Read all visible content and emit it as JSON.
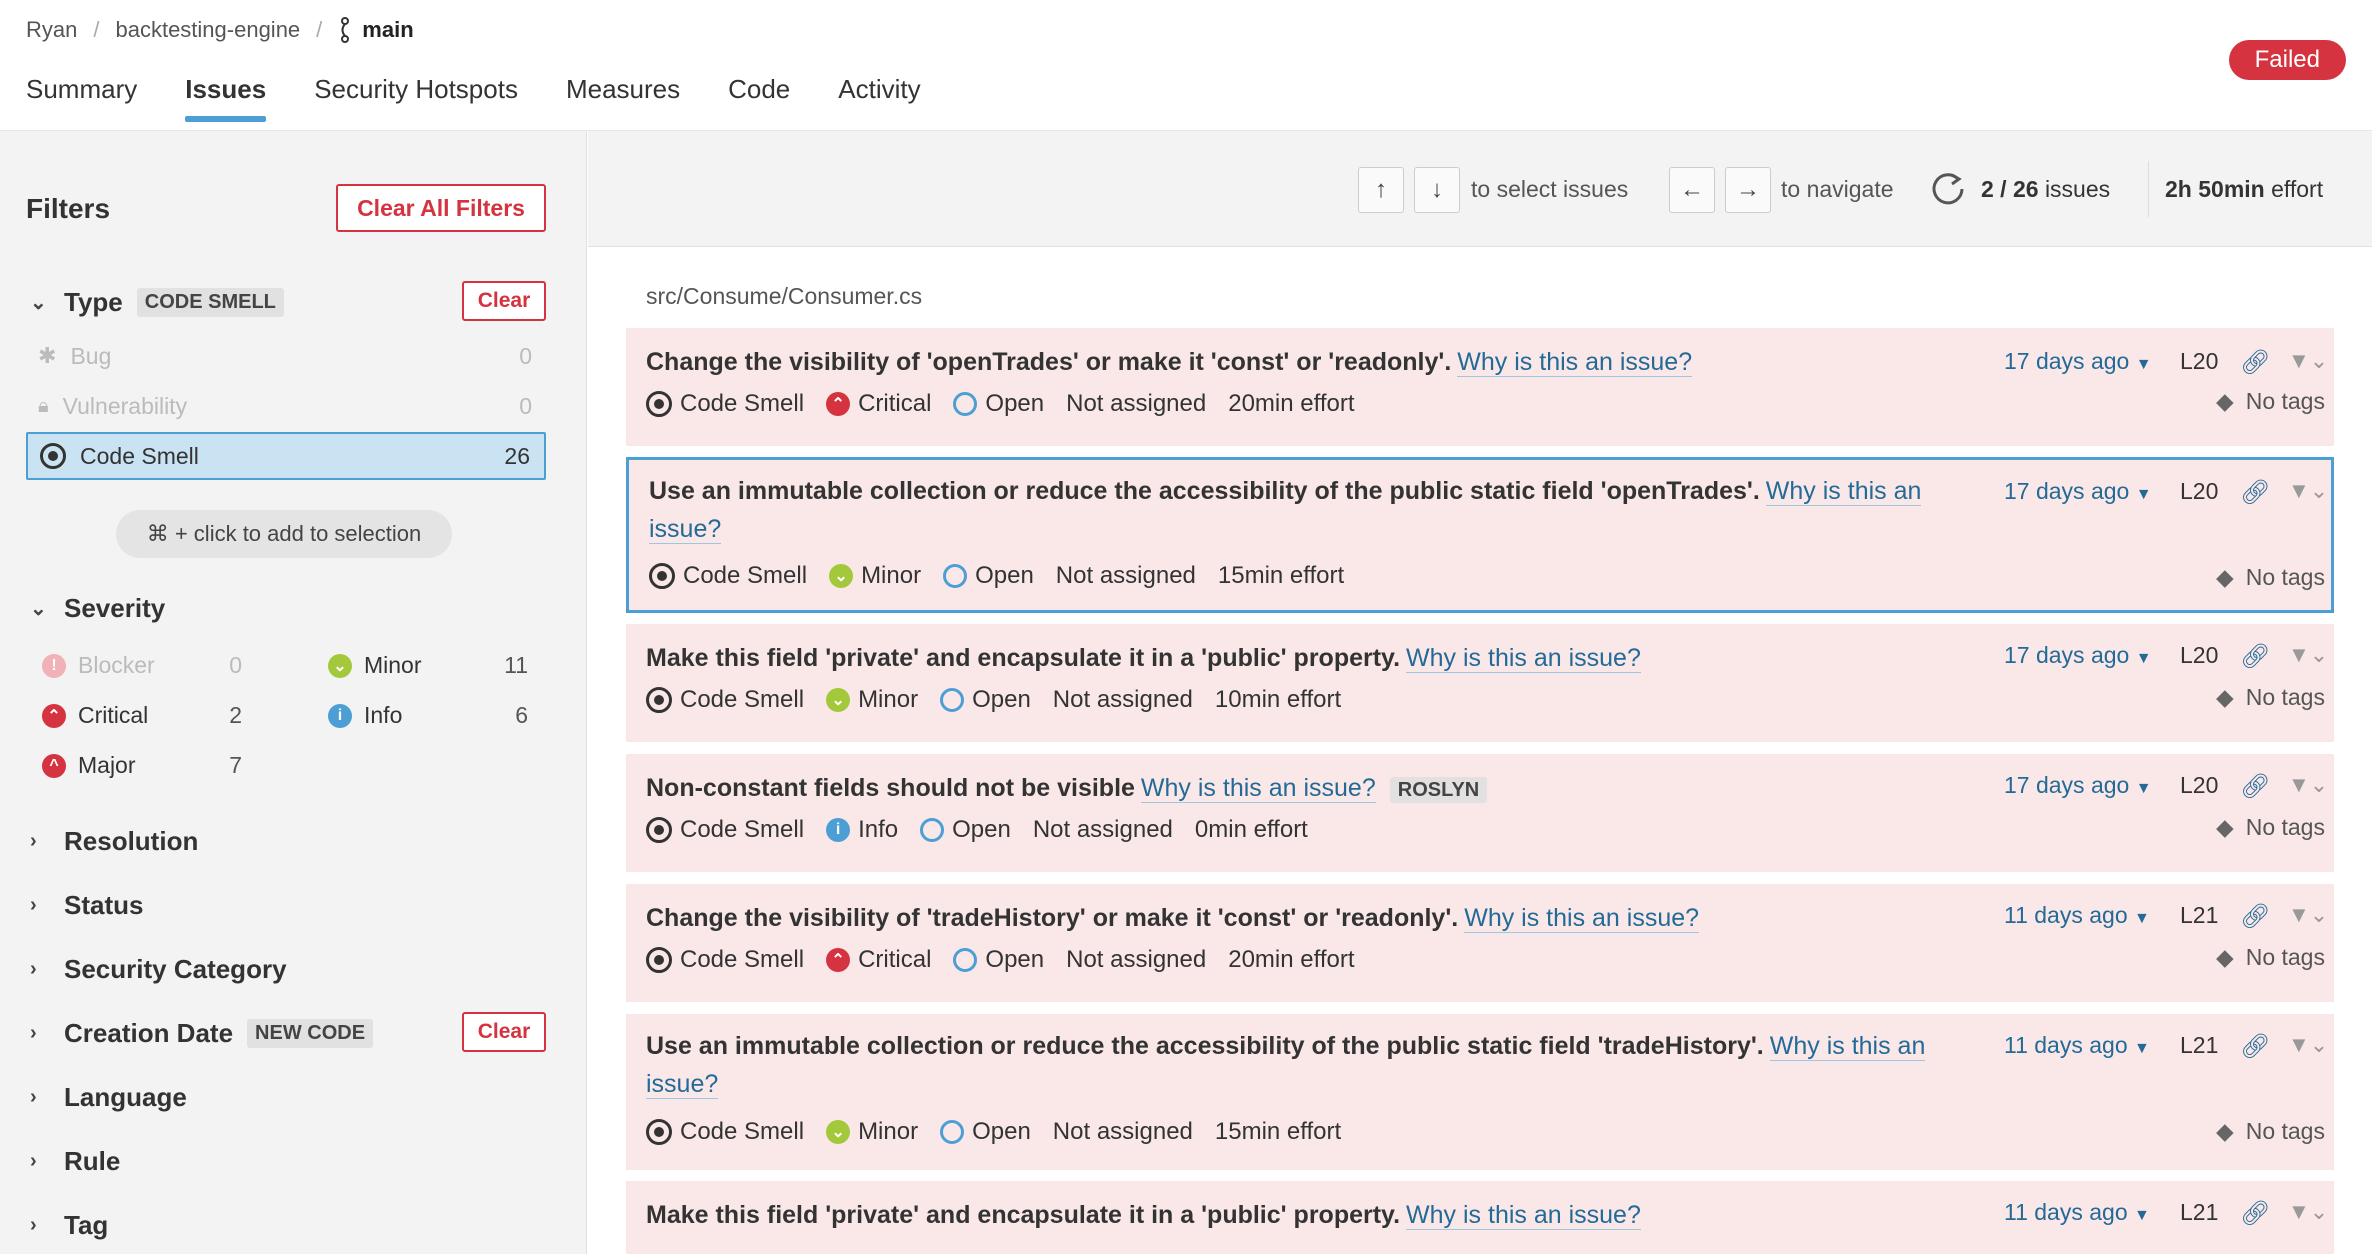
{
  "breadcrumb": {
    "user": "Ryan",
    "project": "backtesting-engine",
    "branch": "main",
    "sep": "/"
  },
  "tabs": [
    "Summary",
    "Issues",
    "Security Hotspots",
    "Measures",
    "Code",
    "Activity"
  ],
  "quality_gate": "Failed",
  "sidebar": {
    "title": "Filters",
    "clear_all": "Clear All Filters",
    "type": {
      "label": "Type",
      "chip": "CODE SMELL",
      "clear": "Clear",
      "items": [
        {
          "label": "Bug",
          "count": "0"
        },
        {
          "label": "Vulnerability",
          "count": "0"
        },
        {
          "label": "Code Smell",
          "count": "26"
        }
      ]
    },
    "hint": "⌘ + click to add to selection",
    "severity": {
      "label": "Severity",
      "items": [
        {
          "label": "Blocker",
          "count": "0"
        },
        {
          "label": "Critical",
          "count": "2"
        },
        {
          "label": "Major",
          "count": "7"
        },
        {
          "label": "Minor",
          "count": "11"
        },
        {
          "label": "Info",
          "count": "6"
        }
      ]
    },
    "resolution": "Resolution",
    "status": "Status",
    "security_category": "Security Category",
    "creation_date": {
      "label": "Creation Date",
      "chip": "NEW CODE",
      "clear": "Clear"
    },
    "language": "Language",
    "rule": "Rule",
    "tag": "Tag"
  },
  "toolbar": {
    "up": "↑",
    "down": "↓",
    "select_text": "to select issues",
    "left": "←",
    "right": "→",
    "nav_text": "to navigate",
    "current": "2 / 26",
    "issues_word": "issues",
    "effort_value": "2h 50min",
    "effort_word": "effort"
  },
  "file_path": "src/Consume/Consumer.cs",
  "why_label": "Why is this an issue?",
  "issues": [
    {
      "title": "Change the visibility of 'openTrades' or make it 'const' or 'readonly'.",
      "type": "Code Smell",
      "severity": "Critical",
      "status": "Open",
      "assignee": "Not assigned",
      "effort": "20min effort",
      "age": "17 days ago",
      "line": "L20",
      "tags": "No tags"
    },
    {
      "title": "Use an immutable collection or reduce the accessibility of the public static field 'openTrades'.",
      "why_a": "Why is this an",
      "why_b": "issue?",
      "type": "Code Smell",
      "severity": "Minor",
      "status": "Open",
      "assignee": "Not assigned",
      "effort": "15min effort",
      "age": "17 days ago",
      "line": "L20",
      "tags": "No tags"
    },
    {
      "title": "Make this field 'private' and encapsulate it in a 'public' property.",
      "type": "Code Smell",
      "severity": "Minor",
      "status": "Open",
      "assignee": "Not assigned",
      "effort": "10min effort",
      "age": "17 days ago",
      "line": "L20",
      "tags": "No tags"
    },
    {
      "title": "Non-constant fields should not be visible",
      "tag_chip": "ROSLYN",
      "type": "Code Smell",
      "severity": "Info",
      "status": "Open",
      "assignee": "Not assigned",
      "effort": "0min effort",
      "age": "17 days ago",
      "line": "L20",
      "tags": "No tags"
    },
    {
      "title": "Change the visibility of 'tradeHistory' or make it 'const' or 'readonly'.",
      "type": "Code Smell",
      "severity": "Critical",
      "status": "Open",
      "assignee": "Not assigned",
      "effort": "20min effort",
      "age": "11 days ago",
      "line": "L21",
      "tags": "No tags"
    },
    {
      "title": "Use an immutable collection or reduce the accessibility of the public static field 'tradeHistory'.",
      "why_a": "Why is this an",
      "why_b": "issue?",
      "type": "Code Smell",
      "severity": "Minor",
      "status": "Open",
      "assignee": "Not assigned",
      "effort": "15min effort",
      "age": "11 days ago",
      "line": "L21",
      "tags": "No tags"
    },
    {
      "title": "Make this field 'private' and encapsulate it in a 'public' property.",
      "age": "11 days ago",
      "line": "L21"
    }
  ],
  "colors": {
    "critical": "#d4333f",
    "minor": "#a4c83c",
    "info": "#4b9fd5",
    "accent": "#4b9fd5",
    "failed": "#d4333f"
  }
}
